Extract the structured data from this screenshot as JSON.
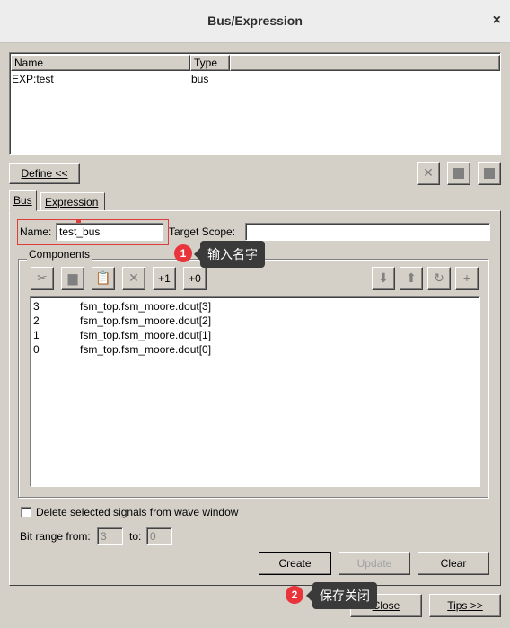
{
  "window": {
    "title": "Bus/Expression",
    "close_glyph": "×"
  },
  "list": {
    "headers": [
      "Name",
      "Type"
    ],
    "rows": [
      {
        "name": "EXP:test",
        "type": "bus"
      }
    ]
  },
  "define_button": "Define <<",
  "right_icons": [
    "delete-icon",
    "square-icon",
    "square-icon"
  ],
  "tabs": [
    "Bus",
    "Expression"
  ],
  "name_label": "Name:",
  "name_value": "test_bus",
  "target_scope_label": "Target Scope:",
  "target_scope_value": "",
  "components_label": "Components",
  "toolbar": {
    "cut": "✂",
    "copy": "▆",
    "paste": "📋",
    "delete": "✕",
    "plus1": "+1",
    "plus0": "+0",
    "down": "⬇",
    "up": "⬆",
    "refresh": "↻",
    "add": "+"
  },
  "components": [
    {
      "index": "3",
      "signal": "fsm_top.fsm_moore.dout[3]"
    },
    {
      "index": "2",
      "signal": "fsm_top.fsm_moore.dout[2]"
    },
    {
      "index": "1",
      "signal": "fsm_top.fsm_moore.dout[1]"
    },
    {
      "index": "0",
      "signal": "fsm_top.fsm_moore.dout[0]"
    }
  ],
  "delete_checkbox_label": "Delete selected signals from wave window",
  "bit_range": {
    "from_label": "Bit range from:",
    "from_value": "3",
    "to_label": "to:",
    "to_value": "0"
  },
  "buttons": {
    "create": "Create",
    "update": "Update",
    "clear": "Clear",
    "close": "Close",
    "tips": "Tips >>"
  },
  "annotations": [
    {
      "number": "1",
      "text": "输入名字"
    },
    {
      "number": "2",
      "text": "保存关闭"
    }
  ]
}
